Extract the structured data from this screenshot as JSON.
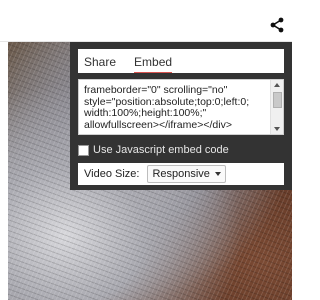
{
  "tabs": [
    {
      "label": "Share"
    },
    {
      "label": "Embed"
    }
  ],
  "embed": {
    "code_lines": [
      "frameborder=\"0\" scrolling=\"no\"",
      "style=\"position:absolute;top:0;left:0;",
      "width:100%;height:100%;\"",
      "allowfullscreen></iframe></div>"
    ],
    "js_option_label": "Use Javascript embed code",
    "video_size_label": "Video Size:",
    "video_size_value": "Responsive"
  },
  "icons": {
    "share": "share-icon"
  },
  "colors": {
    "panel": "#333333",
    "accent": "#d9534f"
  }
}
